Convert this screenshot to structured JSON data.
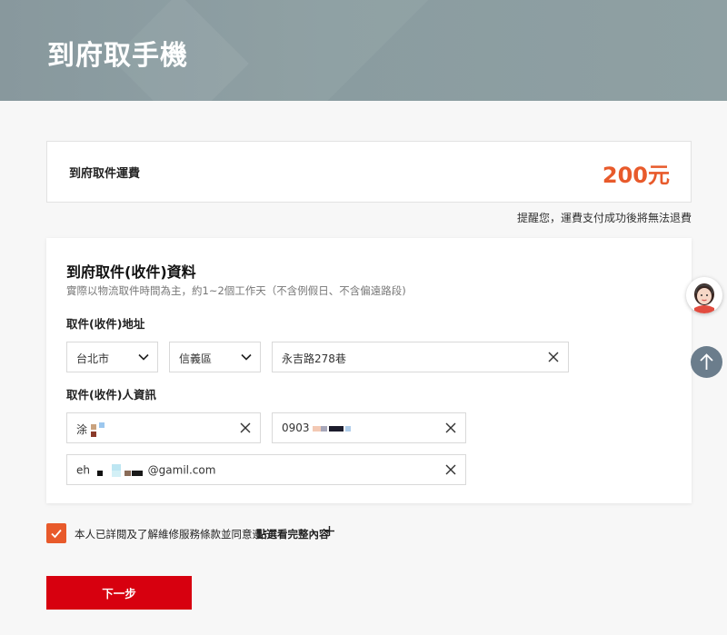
{
  "banner": {
    "title": "到府取手機"
  },
  "fee": {
    "label": "到府取件運費",
    "amount": "200元",
    "note": "提醒您，運費支付成功後將無法退費"
  },
  "form": {
    "title": "到府取件(收件)資料",
    "subtitle": "實際以物流取件時間為主，約1~2個工作天（不含例假日、不含偏遠路段)",
    "address_label": "取件(收件)地址",
    "city": "台北市",
    "district": "信義區",
    "street": "永吉路278巷",
    "contact_label": "取件(收件)人資訊",
    "name_prefix": "涂",
    "phone_prefix": "0903",
    "email_prefix": "eh",
    "email_suffix": "@gamil.com"
  },
  "agreement": {
    "text": "本人已詳閱及了解維修服務條款並同意遵守",
    "link": "點選看完整內容"
  },
  "actions": {
    "next_label": "下一步"
  },
  "colors": {
    "accent": "#e85a2b",
    "primary_button": "#d7000f",
    "banner": "#8a9ca0"
  }
}
